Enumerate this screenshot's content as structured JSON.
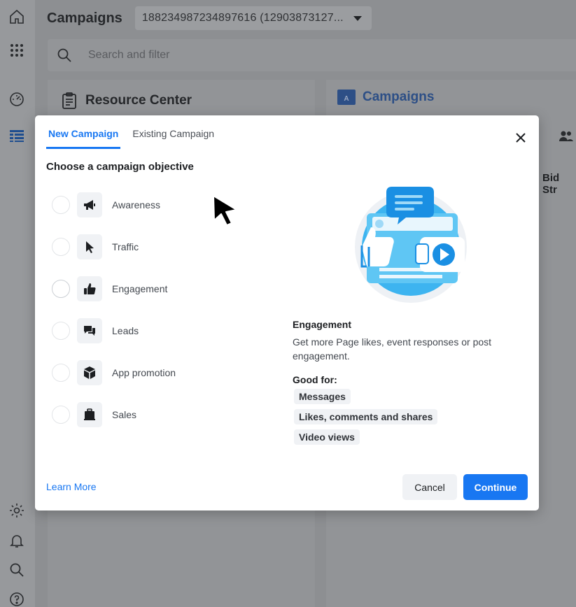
{
  "app": {
    "title": "Campaigns",
    "account_selector": "188234987234897616 (12903873127...",
    "search_placeholder": "Search and filter",
    "resource_center_title": "Resource Center",
    "campaigns_panel_title": "Campaigns",
    "column_header_partial": "Bid Str",
    "folder_letter": "A"
  },
  "sidebar": {
    "icons": [
      "home-icon",
      "apps-grid-icon",
      "dashboard-gauge-icon",
      "table-icon",
      "gear-icon",
      "bell-icon",
      "search-icon",
      "help-icon"
    ]
  },
  "modal": {
    "tabs": [
      {
        "label": "New Campaign",
        "active": true
      },
      {
        "label": "Existing Campaign",
        "active": false
      }
    ],
    "heading": "Choose a campaign objective",
    "objectives": [
      {
        "label": "Awareness",
        "icon": "megaphone-icon"
      },
      {
        "label": "Traffic",
        "icon": "pointer-icon"
      },
      {
        "label": "Engagement",
        "icon": "thumbs-up-icon",
        "selected": true
      },
      {
        "label": "Leads",
        "icon": "chat-bubbles-icon"
      },
      {
        "label": "App promotion",
        "icon": "cube-icon"
      },
      {
        "label": "Sales",
        "icon": "briefcase-icon"
      }
    ],
    "detail": {
      "title": "Engagement",
      "description": "Get more Page likes, event responses or post engagement.",
      "good_for_label": "Good for:",
      "good_for": [
        "Messages",
        "Likes, comments and shares",
        "Video views"
      ]
    },
    "footer": {
      "learn_more": "Learn More",
      "cancel": "Cancel",
      "continue": "Continue"
    }
  },
  "colors": {
    "accent": "#1877f2",
    "overlay": "#8d8f92"
  }
}
